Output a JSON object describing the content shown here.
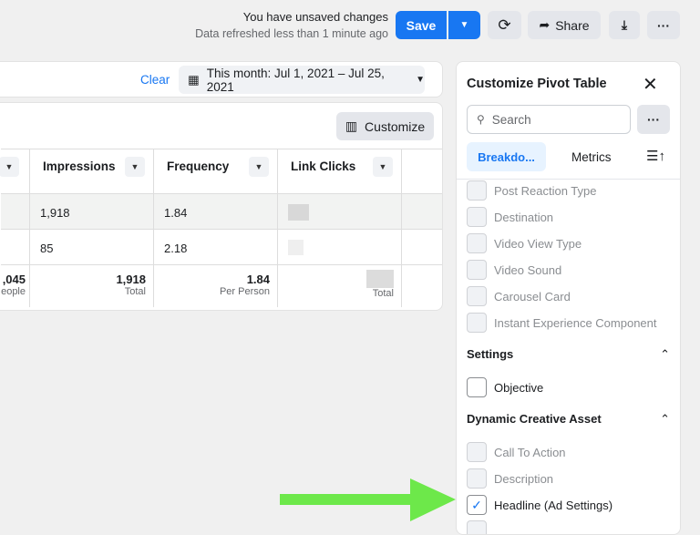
{
  "header": {
    "unsaved": "You have unsaved changes",
    "refreshed": "Data refreshed less than 1 minute ago",
    "save": "Save",
    "share": "Share"
  },
  "filters": {
    "clear": "Clear",
    "date_range": "This month: Jul 1, 2021 – Jul 25, 2021"
  },
  "table": {
    "customize": "Customize",
    "columns": [
      "Impressions",
      "Frequency",
      "Link Clicks"
    ],
    "rows": [
      [
        "1,918",
        "1.84"
      ],
      [
        "85",
        "2.18"
      ]
    ],
    "totals": {
      "first_value": ",045",
      "first_label": "eople",
      "impressions": "1,918",
      "impressions_label": "Total",
      "frequency": "1.84",
      "frequency_label": "Per Person",
      "link_clicks_label": "Total"
    }
  },
  "panel": {
    "title": "Customize Pivot Table",
    "search_placeholder": "Search",
    "tabs": [
      "Breakdo...",
      "Metrics"
    ],
    "items_top": [
      "Post Reaction Type",
      "Destination",
      "Video View Type",
      "Video Sound",
      "Carousel Card",
      "Instant Experience Component"
    ],
    "settings": {
      "title": "Settings",
      "items": [
        "Objective"
      ]
    },
    "dca": {
      "title": "Dynamic Creative Asset",
      "items": [
        "Call To Action",
        "Description",
        "Headline (Ad Settings)"
      ]
    }
  },
  "colors": {
    "accent": "#1877f2",
    "arrow": "#6de84a"
  }
}
